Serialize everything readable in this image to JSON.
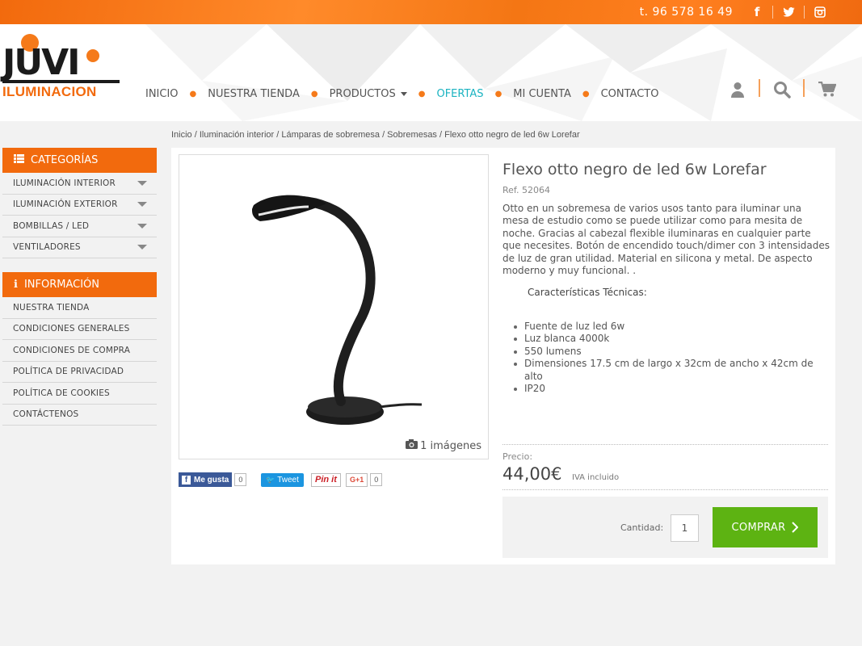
{
  "topbar": {
    "phone": "t. 96 578 16 49",
    "social": [
      {
        "icon": "facebook-icon",
        "glyph": "f"
      },
      {
        "icon": "twitter-icon",
        "glyph": "🐦"
      },
      {
        "icon": "instagram-icon",
        "glyph": "◙"
      }
    ]
  },
  "brand": {
    "logo_top": "JUVI",
    "logo_bottom": "ILUMINACION",
    "accent": "#f26a0d"
  },
  "nav": {
    "items": [
      "INICIO",
      "NUESTRA TIENDA",
      "PRODUCTOS",
      "OFERTAS",
      "MI CUENTA",
      "CONTACTO"
    ],
    "active": "OFERTAS"
  },
  "header_icons": [
    "user-icon",
    "search-icon",
    "cart-icon"
  ],
  "breadcrumb": "Inicio / Iluminación interior / Lámparas de sobremesa / Sobremesas / Flexo otto negro de led 6w Lorefar",
  "sidebar": {
    "categories_title": "CATEGORÍAS",
    "categories": [
      "ILUMINACIÓN INTERIOR",
      "ILUMINACIÓN EXTERIOR",
      "BOMBILLAS / LED",
      "VENTILADORES"
    ],
    "info_title": "INFORMACIÓN",
    "info": [
      "NUESTRA TIENDA",
      "CONDICIONES GENERALES",
      "CONDICIONES DE COMPRA",
      "POLÍTICA DE PRIVACIDAD",
      "POLÍTICA DE COOKIES",
      "CONTÁCTENOS"
    ]
  },
  "product": {
    "title": "Flexo otto negro de led 6w Lorefar",
    "ref": "Ref. 52064",
    "description": "Otto en un sobremesa de varios usos tanto para iluminar una mesa de estudio como se puede utilizar como para mesita de noche. Gracias al cabezal flexible iluminaras en cualquier parte que necesites. Botón de encendido touch/dimer con 3 intensidades de luz de gran utilidad. Material en silicona y metal. De aspecto moderno y muy funcional. .",
    "specs_title": "Características Técnicas:",
    "specs": [
      "Fuente de luz led 6w",
      "Luz blanca 4000k",
      "550 lumens",
      "Dimensiones 17.5 cm de largo x 32cm de ancho x 42cm de alto",
      "IP20"
    ],
    "images_label": "1 imágenes",
    "price_label": "Precio:",
    "price": "44,00€",
    "tax_note": "IVA incluido",
    "quantity_label": "Cantidad:",
    "quantity": "1",
    "buy_label": "COMPRAR"
  },
  "share": {
    "like_label": "Me gusta",
    "like_count": "0",
    "tweet_label": "Tweet",
    "pin_label": "Pin it",
    "gplus_label": "G+1",
    "gplus_count": "0"
  }
}
